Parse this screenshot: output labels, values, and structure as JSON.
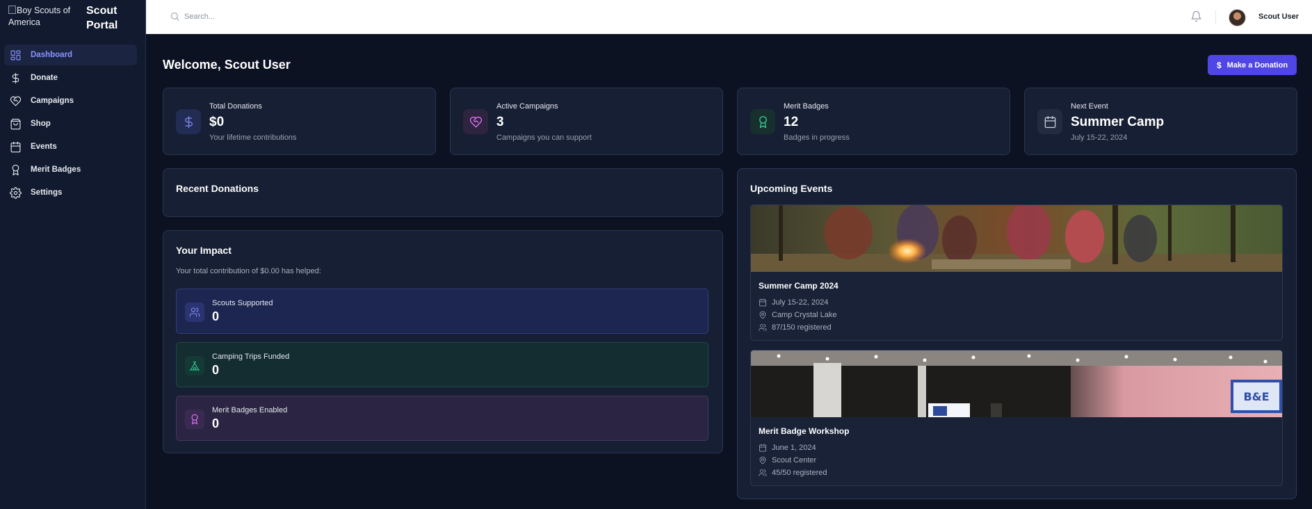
{
  "brand": {
    "logo_alt": "Boy Scouts of America",
    "title_line1": "Scout",
    "title_line2": "Portal"
  },
  "sidebar": {
    "items": [
      {
        "label": "Dashboard",
        "icon": "dashboard-icon",
        "active": true
      },
      {
        "label": "Donate",
        "icon": "dollar-icon"
      },
      {
        "label": "Campaigns",
        "icon": "heart-handshake-icon"
      },
      {
        "label": "Shop",
        "icon": "shopping-bag-icon"
      },
      {
        "label": "Events",
        "icon": "calendar-icon"
      },
      {
        "label": "Merit Badges",
        "icon": "award-icon"
      },
      {
        "label": "Settings",
        "icon": "gear-icon"
      }
    ]
  },
  "topbar": {
    "search_placeholder": "Search...",
    "username": "Scout User"
  },
  "main": {
    "welcome": "Welcome, Scout User",
    "donate_button": "Make a Donation",
    "stats": [
      {
        "label": "Total Donations",
        "value": "$0",
        "sub": "Your lifetime contributions",
        "icon": "dollar-icon",
        "color": "#818cf8"
      },
      {
        "label": "Active Campaigns",
        "value": "3",
        "sub": "Campaigns you can support",
        "icon": "heart-handshake-icon",
        "color": "#e879f9"
      },
      {
        "label": "Merit Badges",
        "value": "12",
        "sub": "Badges in progress",
        "icon": "award-icon",
        "color": "#34d399"
      },
      {
        "label": "Next Event",
        "value": "Summer Camp",
        "sub": "July 15-22, 2024",
        "icon": "calendar-icon",
        "color": "#cbd5e1"
      }
    ],
    "recent_donations": {
      "title": "Recent Donations"
    },
    "impact": {
      "title": "Your Impact",
      "note": "Your total contribution of $0.00 has helped:",
      "rows": [
        {
          "label": "Scouts Supported",
          "value": "0",
          "icon": "users-icon"
        },
        {
          "label": "Camping Trips Funded",
          "value": "0",
          "icon": "tent-icon"
        },
        {
          "label": "Merit Badges Enabled",
          "value": "0",
          "icon": "award-icon"
        }
      ]
    },
    "events": {
      "title": "Upcoming Events",
      "items": [
        {
          "name": "Summer Camp 2024",
          "date": "July 15-22, 2024",
          "location": "Camp Crystal Lake",
          "registered": "87/150 registered"
        },
        {
          "name": "Merit Badge Workshop",
          "date": "June 1, 2024",
          "location": "Scout Center",
          "registered": "45/50 registered"
        }
      ]
    }
  },
  "colors": {
    "accent": "#4f46e5",
    "active_nav": "#8b93ff",
    "background": "#0c1222",
    "card": "#161f33"
  }
}
